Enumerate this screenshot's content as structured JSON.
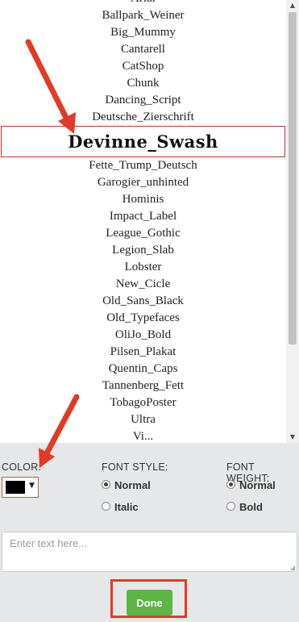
{
  "font_list": {
    "items": [
      "Arial",
      "Ballpark_Weiner",
      "Big_Mummy",
      "Cantarell",
      "CatShop",
      "Chunk",
      "Dancing_Script",
      "Deutsche_Zierschrift",
      "Devinne_Swash",
      "Fette_Trump_Deutsch",
      "Garogier_unhinted",
      "Hominis",
      "Impact_Label",
      "League_Gothic",
      "Legion_Slab",
      "Lobster",
      "New_Cicle",
      "Old_Sans_Black",
      "Old_Typefaces",
      "OliJo_Bold",
      "Pilsen_Plakat",
      "Quentin_Caps",
      "Tannenberg_Fett",
      "TobagoPoster",
      "Ultra",
      "Vi..."
    ],
    "selected": "Devinne_Swash"
  },
  "scrollbar": {
    "up_glyph": "▲",
    "down_glyph": "▼"
  },
  "color": {
    "label": "COLOR:",
    "value": "#000000",
    "caret": "▼"
  },
  "font_style": {
    "label": "FONT STYLE:",
    "options": [
      {
        "label": "Normal",
        "checked": true
      },
      {
        "label": "Italic",
        "checked": false
      }
    ]
  },
  "font_weight": {
    "label": "FONT WEIGHT:",
    "options": [
      {
        "label": "Normal",
        "checked": true
      },
      {
        "label": "Bold",
        "checked": false
      }
    ]
  },
  "text_input": {
    "placeholder": "Enter text here...",
    "value": ""
  },
  "done_button": {
    "label": "Done",
    "color": "#5cb544"
  },
  "accent": {
    "highlight": "#c0302f",
    "arrow": "#e23a2a"
  }
}
